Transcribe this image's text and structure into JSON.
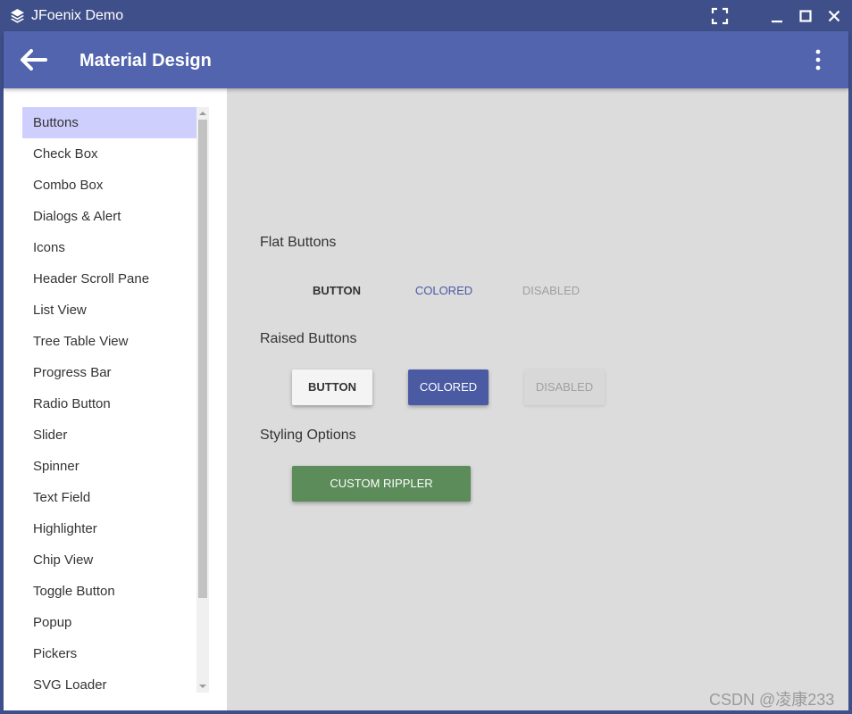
{
  "window": {
    "title": "JFoenix Demo",
    "icons": {
      "app": "layers-icon",
      "fullscreen": "fullscreen-icon",
      "minimize": "minimize-icon",
      "maximize": "maximize-icon",
      "close": "close-icon"
    }
  },
  "appbar": {
    "title": "Material Design",
    "back_icon": "arrow-left-icon",
    "menu_icon": "more-vertical-icon"
  },
  "sidebar": {
    "items": [
      {
        "label": "Buttons",
        "selected": true
      },
      {
        "label": "Check Box"
      },
      {
        "label": "Combo Box"
      },
      {
        "label": "Dialogs & Alert"
      },
      {
        "label": "Icons"
      },
      {
        "label": "Header Scroll Pane"
      },
      {
        "label": "List View"
      },
      {
        "label": "Tree Table View"
      },
      {
        "label": "Progress Bar"
      },
      {
        "label": "Radio Button"
      },
      {
        "label": "Slider"
      },
      {
        "label": "Spinner"
      },
      {
        "label": "Text Field"
      },
      {
        "label": "Highlighter"
      },
      {
        "label": "Chip View"
      },
      {
        "label": "Toggle Button"
      },
      {
        "label": "Popup"
      },
      {
        "label": "Pickers"
      },
      {
        "label": "SVG Loader"
      }
    ]
  },
  "main": {
    "flat_section": {
      "label": "Flat Buttons",
      "buttons": {
        "default": "BUTTON",
        "colored": "COLORED",
        "disabled": "DISABLED"
      }
    },
    "raised_section": {
      "label": "Raised Buttons",
      "buttons": {
        "default": "BUTTON",
        "colored": "COLORED",
        "disabled": "DISABLED"
      }
    },
    "styling_section": {
      "label": "Styling Options",
      "custom_button": "CUSTOM RIPPLER"
    }
  },
  "watermark": "CSDN @凌康233",
  "colors": {
    "titlebar": "#3f4f8a",
    "appbar": "#5264ae",
    "selected_item": "#cfcffd",
    "content_bg": "#dcdcdc",
    "colored_button": "#4a5aa3",
    "custom_button": "#5b8c5a",
    "disabled_text": "#a0a0a0"
  }
}
